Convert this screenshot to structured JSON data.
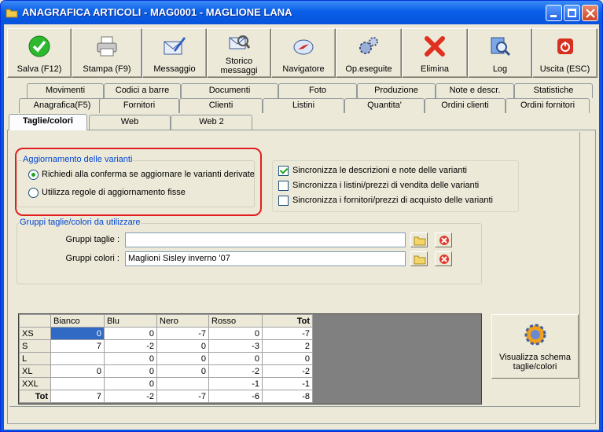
{
  "window": {
    "title": "ANAGRAFICA ARTICOLI - MAG0001 - MAGLIONE LANA"
  },
  "toolbar": {
    "buttons": [
      {
        "label": "Salva (F12)",
        "icon": "check-icon"
      },
      {
        "label": "Stampa (F9)",
        "icon": "printer-icon"
      },
      {
        "label": "Messaggio",
        "icon": "envelope-pen-icon"
      },
      {
        "label": "Storico messaggi",
        "icon": "message-history-icon"
      },
      {
        "label": "Navigatore",
        "icon": "compass-icon"
      },
      {
        "label": "Op.eseguite",
        "icon": "gears-icon"
      },
      {
        "label": "Elimina",
        "icon": "delete-x-icon"
      },
      {
        "label": "Log",
        "icon": "log-magnifier-icon"
      },
      {
        "label": "Uscita (ESC)",
        "icon": "power-icon"
      }
    ]
  },
  "tabs": {
    "row1": [
      "Movimenti",
      "Codici a barre",
      "Documenti",
      "Foto",
      "Produzione",
      "Note e descr.",
      "Statistiche"
    ],
    "row2": [
      "Anagrafica(F5)",
      "Fornitori",
      "Clienti",
      "Listini",
      "Quantita'",
      "Ordini clienti",
      "Ordini fornitori"
    ],
    "row3": [
      "Taglie/colori",
      "Web",
      "Web 2"
    ]
  },
  "variants_update": {
    "legend": "Aggiornamento delle varianti",
    "option_ask": "Richiedi alla conferma se aggiornare le varianti derivate",
    "option_fixed": "Utilizza regole di aggiornamento fisse"
  },
  "sync": {
    "descriptions": "Sincronizza le descrizioni e note delle varianti",
    "price_lists": "Sincronizza i listini/prezzi di vendita delle varianti",
    "suppliers": "Sincronizza i fornitori/prezzi di acquisto delle varianti"
  },
  "groups": {
    "legend": "Gruppi taglie/colori da utilizzare",
    "sizes_label": "Gruppi taglie :",
    "sizes_value": "",
    "colors_label": "Gruppi colori :",
    "colors_value": "Maglioni Sisley inverno '07"
  },
  "grid": {
    "columns": [
      "",
      "Bianco",
      "Blu",
      "Nero",
      "Rosso",
      "Tot"
    ],
    "rows": [
      [
        "XS",
        "0",
        "0",
        "-7",
        "0",
        "-7"
      ],
      [
        "S",
        "7",
        "-2",
        "0",
        "-3",
        "2"
      ],
      [
        "L",
        "",
        "0",
        "0",
        "0",
        "0"
      ],
      [
        "XL",
        "0",
        "0",
        "0",
        "-2",
        "-2"
      ],
      [
        "XXL",
        "",
        "0",
        "",
        "-1",
        "-1"
      ],
      [
        "Tot",
        "7",
        "-2",
        "-7",
        "-6",
        "-8"
      ]
    ]
  },
  "schema_button": {
    "label": "Visualizza schema taglie/colori",
    "icon": "schema-gear-icon"
  }
}
